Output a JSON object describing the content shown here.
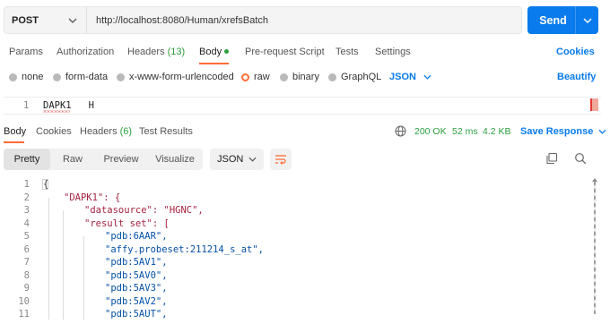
{
  "request": {
    "method": "POST",
    "url": "http://localhost:8080/Human/xrefsBatch",
    "send_label": "Send"
  },
  "request_tabs": [
    {
      "label": "Params"
    },
    {
      "label": "Authorization"
    },
    {
      "label": "Headers",
      "count": "(13)"
    },
    {
      "label": "Body"
    },
    {
      "label": "Pre-request Script"
    },
    {
      "label": "Tests"
    },
    {
      "label": "Settings"
    }
  ],
  "cookies_label": "Cookies",
  "body_types": [
    "none",
    "form-data",
    "x-www-form-urlencoded",
    "raw",
    "binary",
    "GraphQL"
  ],
  "body_type_selected": "raw",
  "body_format": "JSON",
  "beautify_label": "Beautify",
  "request_body": {
    "line_number": "1",
    "text": "DAPK1   H"
  },
  "response_tabs": [
    {
      "label": "Body"
    },
    {
      "label": "Cookies"
    },
    {
      "label": "Headers",
      "count": "(6)"
    },
    {
      "label": "Test Results"
    }
  ],
  "response_meta": {
    "status": "200 OK",
    "time": "52 ms",
    "size": "4.2 KB",
    "save_label": "Save Response"
  },
  "view_modes": [
    "Pretty",
    "Raw",
    "Preview",
    "Visualize"
  ],
  "view_selected": "Pretty",
  "response_format": "JSON",
  "response_lines": [
    {
      "n": "1",
      "text": "{"
    },
    {
      "n": "2",
      "text": "\"DAPK1\": {"
    },
    {
      "n": "3",
      "text": "\"datasource\": \"HGNC\","
    },
    {
      "n": "4",
      "text": "\"result set\": ["
    },
    {
      "n": "5",
      "text": "\"pdb:6AAR\","
    },
    {
      "n": "6",
      "text": "\"affy.probeset:211214_s_at\","
    },
    {
      "n": "7",
      "text": "\"pdb:5AV1\","
    },
    {
      "n": "8",
      "text": "\"pdb:5AV0\","
    },
    {
      "n": "9",
      "text": "\"pdb:5AV3\","
    },
    {
      "n": "10",
      "text": "\"pdb:5AV2\","
    },
    {
      "n": "11",
      "text": "\"pdb:5AUT\","
    }
  ],
  "colors": {
    "accent": "#ff6c37",
    "primary": "#097bed",
    "success": "#2b9f3e"
  }
}
